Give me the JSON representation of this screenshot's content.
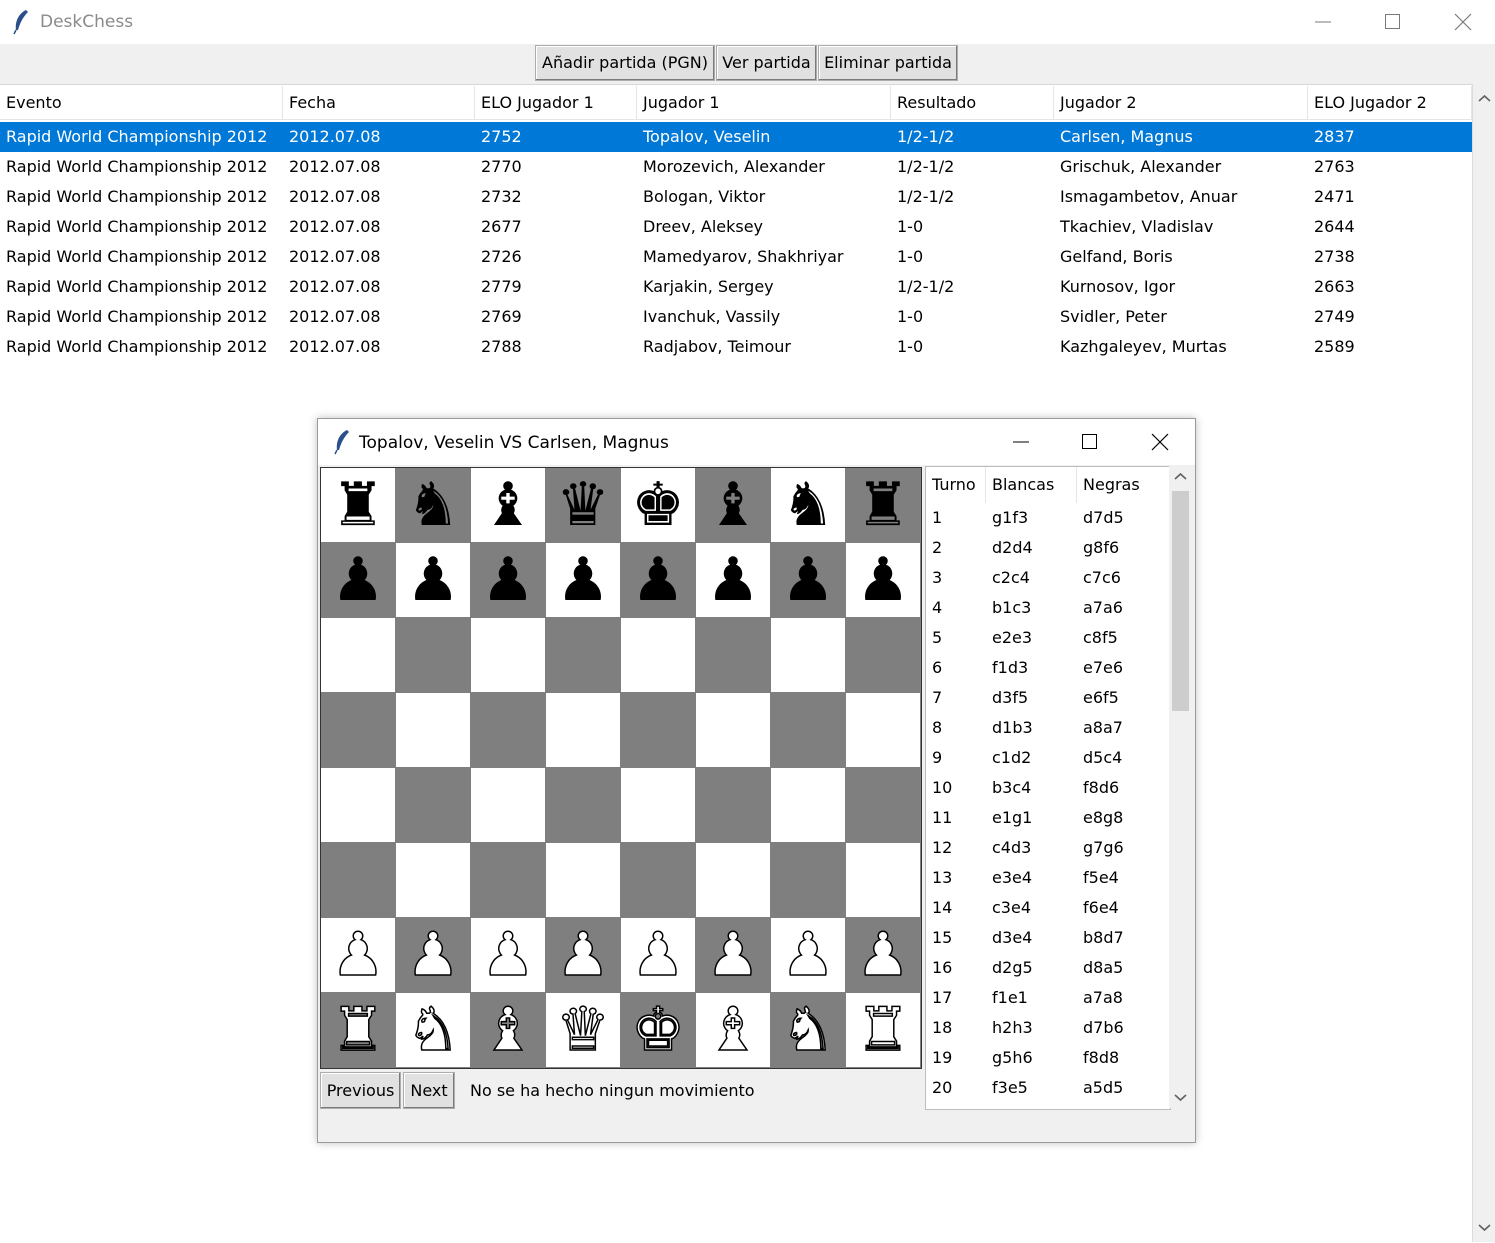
{
  "app": {
    "title": "DeskChess",
    "toolbar": {
      "add_label": "Añadir partida (PGN)",
      "view_label": "Ver partida",
      "delete_label": "Eliminar partida"
    },
    "columns": [
      "Evento",
      "Fecha",
      "ELO Jugador 1",
      "Jugador 1",
      "Resultado",
      "Jugador 2",
      "ELO Jugador 2"
    ],
    "games": [
      {
        "event": "Rapid World Championship 2012",
        "date": "2012.07.08",
        "elo1": "2752",
        "player1": "Topalov, Veselin",
        "result": "1/2-1/2",
        "player2": "Carlsen, Magnus",
        "elo2": "2837"
      },
      {
        "event": "Rapid World Championship 2012",
        "date": "2012.07.08",
        "elo1": "2770",
        "player1": "Morozevich, Alexander",
        "result": "1/2-1/2",
        "player2": "Grischuk, Alexander",
        "elo2": "2763"
      },
      {
        "event": "Rapid World Championship 2012",
        "date": "2012.07.08",
        "elo1": "2732",
        "player1": "Bologan, Viktor",
        "result": "1/2-1/2",
        "player2": "Ismagambetov, Anuar",
        "elo2": "2471"
      },
      {
        "event": "Rapid World Championship 2012",
        "date": "2012.07.08",
        "elo1": "2677",
        "player1": "Dreev, Aleksey",
        "result": "1-0",
        "player2": "Tkachiev, Vladislav",
        "elo2": "2644"
      },
      {
        "event": "Rapid World Championship 2012",
        "date": "2012.07.08",
        "elo1": "2726",
        "player1": "Mamedyarov, Shakhriyar",
        "result": "1-0",
        "player2": "Gelfand, Boris",
        "elo2": "2738"
      },
      {
        "event": "Rapid World Championship 2012",
        "date": "2012.07.08",
        "elo1": "2779",
        "player1": "Karjakin, Sergey",
        "result": "1/2-1/2",
        "player2": "Kurnosov, Igor",
        "elo2": "2663"
      },
      {
        "event": "Rapid World Championship 2012",
        "date": "2012.07.08",
        "elo1": "2769",
        "player1": "Ivanchuk, Vassily",
        "result": "1-0",
        "player2": "Svidler, Peter",
        "elo2": "2749"
      },
      {
        "event": "Rapid World Championship 2012",
        "date": "2012.07.08",
        "elo1": "2788",
        "player1": "Radjabov, Teimour",
        "result": "1-0",
        "player2": "Kazhgaleyev, Murtas",
        "elo2": "2589"
      }
    ],
    "selected_row": 0
  },
  "viewer": {
    "title": "Topalov, Veselin VS Carlsen, Magnus",
    "prev_label": "Previous",
    "next_label": "Next",
    "status": "No se ha hecho ningun movimiento",
    "board": [
      [
        "r",
        "n",
        "b",
        "q",
        "k",
        "b",
        "n",
        "r"
      ],
      [
        "p",
        "p",
        "p",
        "p",
        "p",
        "p",
        "p",
        "p"
      ],
      [
        "",
        "",
        "",
        "",
        "",
        "",
        "",
        ""
      ],
      [
        "",
        "",
        "",
        "",
        "",
        "",
        "",
        ""
      ],
      [
        "",
        "",
        "",
        "",
        "",
        "",
        "",
        ""
      ],
      [
        "",
        "",
        "",
        "",
        "",
        "",
        "",
        ""
      ],
      [
        "P",
        "P",
        "P",
        "P",
        "P",
        "P",
        "P",
        "P"
      ],
      [
        "R",
        "N",
        "B",
        "Q",
        "K",
        "B",
        "N",
        "R"
      ]
    ],
    "move_columns": [
      "Turno",
      "Blancas",
      "Negras"
    ],
    "moves": [
      [
        "1",
        "g1f3",
        "d7d5"
      ],
      [
        "2",
        "d2d4",
        "g8f6"
      ],
      [
        "3",
        "c2c4",
        "c7c6"
      ],
      [
        "4",
        "b1c3",
        "a7a6"
      ],
      [
        "5",
        "e2e3",
        "c8f5"
      ],
      [
        "6",
        "f1d3",
        "e7e6"
      ],
      [
        "7",
        "d3f5",
        "e6f5"
      ],
      [
        "8",
        "d1b3",
        "a8a7"
      ],
      [
        "9",
        "c1d2",
        "d5c4"
      ],
      [
        "10",
        "b3c4",
        "f8d6"
      ],
      [
        "11",
        "e1g1",
        "e8g8"
      ],
      [
        "12",
        "c4d3",
        "g7g6"
      ],
      [
        "13",
        "e3e4",
        "f5e4"
      ],
      [
        "14",
        "c3e4",
        "f6e4"
      ],
      [
        "15",
        "d3e4",
        "b8d7"
      ],
      [
        "16",
        "d2g5",
        "d8a5"
      ],
      [
        "17",
        "f1e1",
        "a7a8"
      ],
      [
        "18",
        "h2h3",
        "d7b6"
      ],
      [
        "19",
        "g5h6",
        "f8d8"
      ],
      [
        "20",
        "f3e5",
        "a5d5"
      ]
    ]
  },
  "icons": {
    "app": "feather-icon",
    "minimize": "minimize-icon",
    "maximize": "maximize-icon",
    "close": "close-icon"
  },
  "colors": {
    "selection": "#0078d7",
    "dark_square": "#7f7f7f",
    "light_square": "#ffffff"
  }
}
